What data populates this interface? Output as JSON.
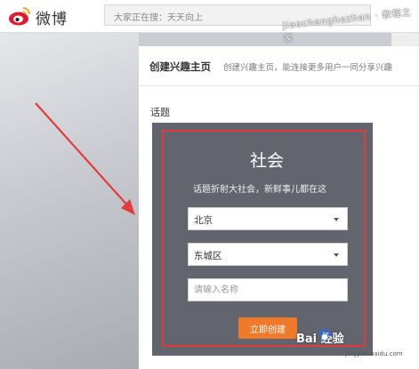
{
  "header": {
    "brand": "微博",
    "search_placeholder": "大家正在搜：天天向上",
    "watermark": "jiaochenghezhan · 教程之家"
  },
  "card": {
    "title": "创建兴趣主页",
    "description": "创建兴趣主页，能连接更多用户一同分享兴趣"
  },
  "section_label": "话题",
  "topic_panel": {
    "title": "社会",
    "subtitle": "话题折射大社会，新鲜事儿都在这",
    "province_value": "北京",
    "district_value": "东城区",
    "name_placeholder": "请输入名称",
    "create_label": "立即创建"
  },
  "footer_watermark": {
    "text": "Bai  经验",
    "url": "jingyan.baidu.com"
  },
  "colors": {
    "panel": "#62656e",
    "frame": "#e23b3b",
    "button": "#f07a2b",
    "arrow": "#e23b3b"
  }
}
